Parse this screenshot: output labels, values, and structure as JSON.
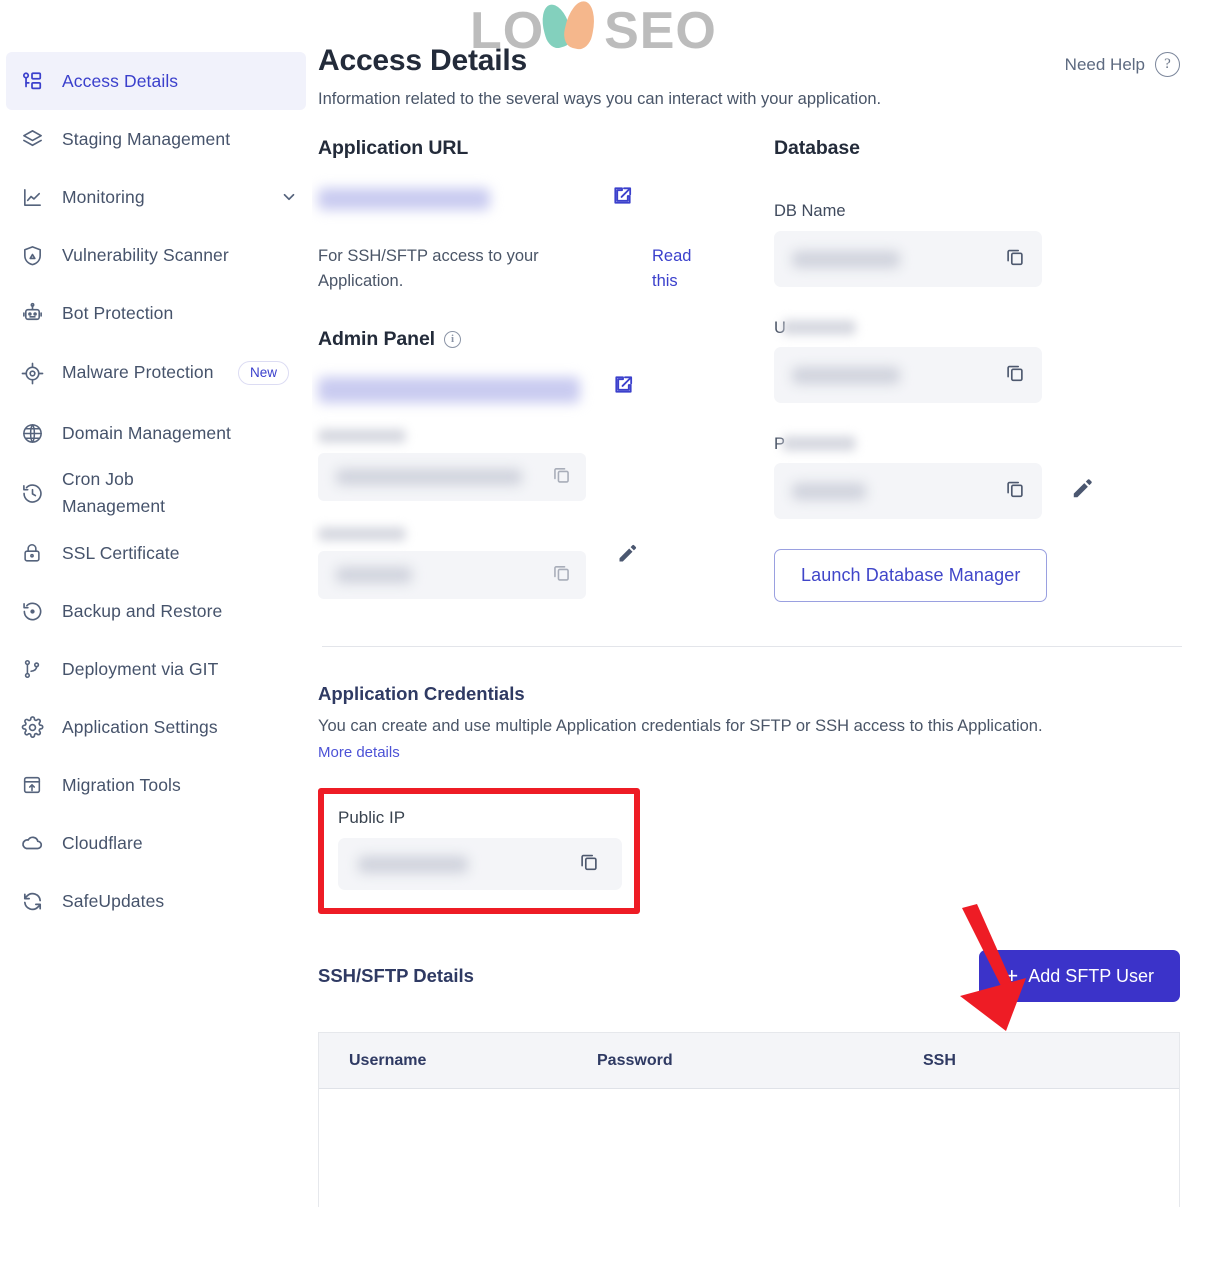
{
  "sidebar": {
    "items": [
      {
        "label": "Access Details",
        "icon": "key-list-icon",
        "active": true
      },
      {
        "label": "Staging Management",
        "icon": "layers-icon"
      },
      {
        "label": "Monitoring",
        "icon": "chart-line-icon",
        "chevron": true
      },
      {
        "label": "Vulnerability Scanner",
        "icon": "shield-alert-icon"
      },
      {
        "label": "Bot Protection",
        "icon": "robot-icon"
      },
      {
        "label": "Malware Protection",
        "icon": "target-bug-icon",
        "badge": "New"
      },
      {
        "label": "Domain Management",
        "icon": "www-globe-icon"
      },
      {
        "label": "Cron Job Management",
        "icon": "clock-history-icon"
      },
      {
        "label": "SSL Certificate",
        "icon": "lock-icon"
      },
      {
        "label": "Backup and Restore",
        "icon": "restore-icon"
      },
      {
        "label": "Deployment via GIT",
        "icon": "git-branch-icon"
      },
      {
        "label": "Application Settings",
        "icon": "gear-icon"
      },
      {
        "label": "Migration Tools",
        "icon": "upload-box-icon"
      },
      {
        "label": "Cloudflare",
        "icon": "cloud-icon"
      },
      {
        "label": "SafeUpdates",
        "icon": "refresh-icon"
      }
    ]
  },
  "header": {
    "title": "Access Details",
    "subtitle": "Information related to the several ways you can interact with your application.",
    "need_help": "Need Help"
  },
  "watermark": {
    "text_left": "LO",
    "text_right": "SEO"
  },
  "application_url": {
    "title": "Application URL",
    "value_redacted": true,
    "hint": "For SSH/SFTP access to your Application.",
    "read_link": "Read this"
  },
  "admin_panel": {
    "title": "Admin Panel",
    "url_redacted": true,
    "fields_redacted": true
  },
  "database": {
    "title": "Database",
    "fields": [
      {
        "label": "DB Name",
        "label_redacted": false,
        "value_redacted": true,
        "has_copy": true
      },
      {
        "label": "U",
        "label_redacted": true,
        "value_redacted": true,
        "has_copy": true
      },
      {
        "label": "P",
        "label_redacted": true,
        "value_redacted": true,
        "has_copy": true,
        "has_edit": true
      }
    ],
    "launch_button": "Launch Database Manager"
  },
  "credentials": {
    "title": "Application Credentials",
    "description": "You can create and use multiple Application credentials for SFTP or SSH access to this Application.",
    "more_details": "More details",
    "public_ip_label": "Public IP",
    "public_ip_redacted": true
  },
  "ssh": {
    "title": "SSH/SFTP Details",
    "add_button": "Add SFTP User",
    "add_button_plus": "+",
    "columns": [
      "Username",
      "Password",
      "SSH"
    ],
    "rows": []
  },
  "colors": {
    "accent": "#3b33c9",
    "accent_link": "#4c52d6",
    "highlight_red": "#ee1c25",
    "sidebar_active_bg": "#f1f2fb",
    "text_dark": "#232b3a"
  }
}
